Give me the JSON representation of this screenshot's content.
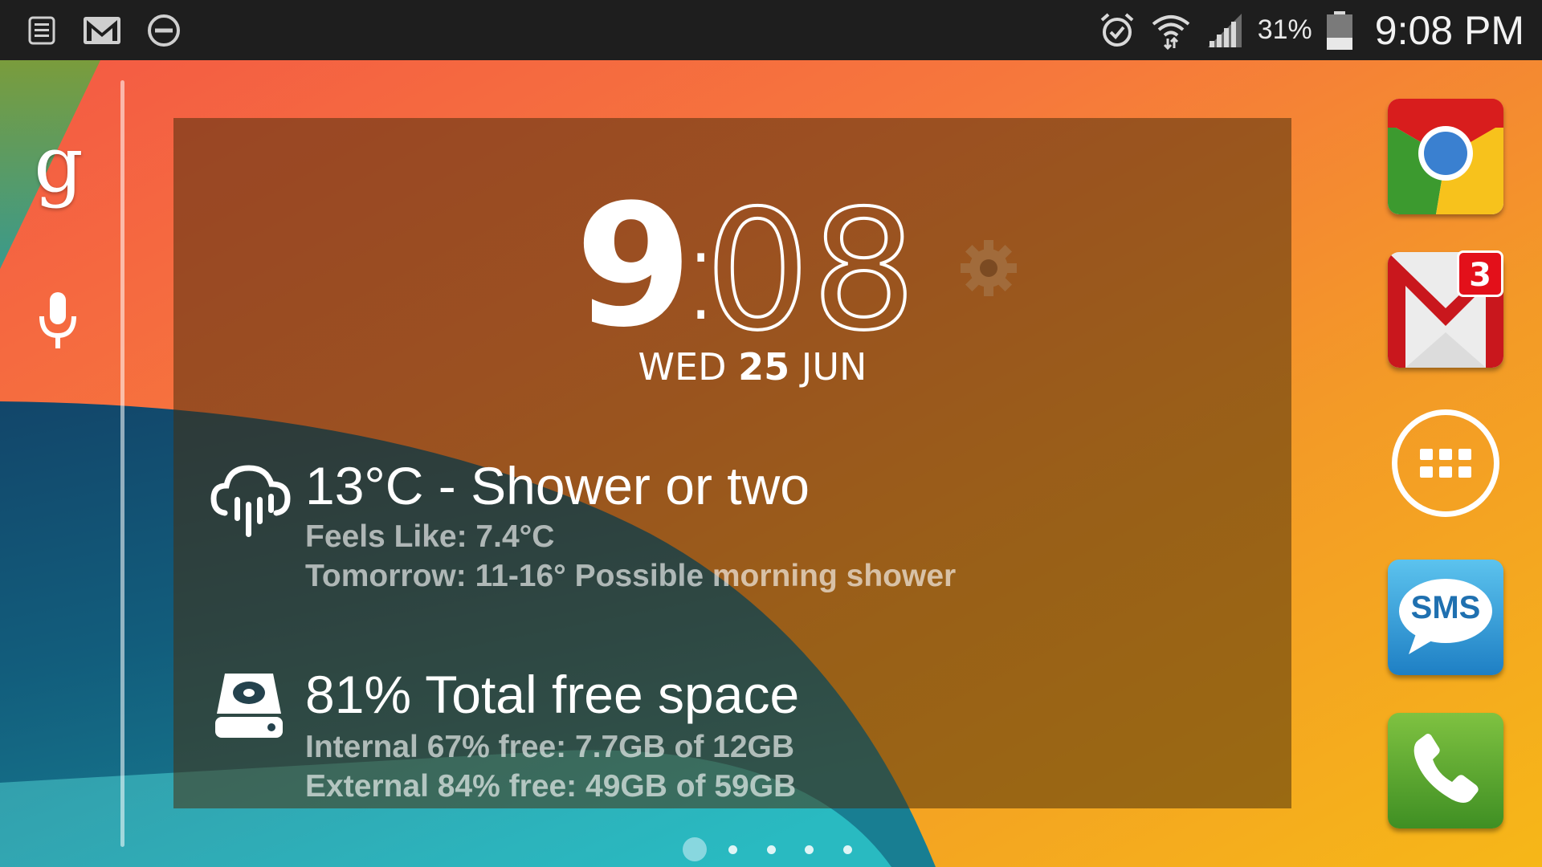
{
  "status_bar": {
    "battery_percent": "31%",
    "time": "9:08 PM",
    "left_icons": [
      "notes-icon",
      "gmail-icon",
      "do-not-disturb-icon"
    ],
    "right_icons": [
      "alarm-icon",
      "wifi-icon",
      "signal-icon",
      "battery-icon"
    ]
  },
  "left_dock": {
    "google_letter": "g",
    "mic_icon": "microphone-icon"
  },
  "clock_widget": {
    "hour": "9",
    "separator": ":",
    "minutes": "08",
    "day": "WED",
    "date": "25",
    "month": "JUN",
    "settings_icon": "gear-icon"
  },
  "weather": {
    "icon": "rain-cloud-icon",
    "title": "13°C - Shower or two",
    "feels_like": "Feels Like: 7.4°C",
    "tomorrow": "Tomorrow: 11-16° Possible morning shower"
  },
  "storage": {
    "icon": "hard-drive-icon",
    "title": "81% Total free space",
    "internal": "Internal 67% free: 7.7GB of 12GB",
    "external": "External 84% free: 49GB of 59GB"
  },
  "right_dock": {
    "apps": [
      "Chrome",
      "Gmail",
      "Apps",
      "SMS",
      "Phone"
    ],
    "gmail_badge": "3",
    "sms_label": "SMS"
  },
  "pager": {
    "pages": 5,
    "active": 0
  },
  "colors": {
    "accent_teal": "#88d7df",
    "badge_red": "#e3101a",
    "widget_bg": "rgba(70,45,10,0.52)"
  }
}
